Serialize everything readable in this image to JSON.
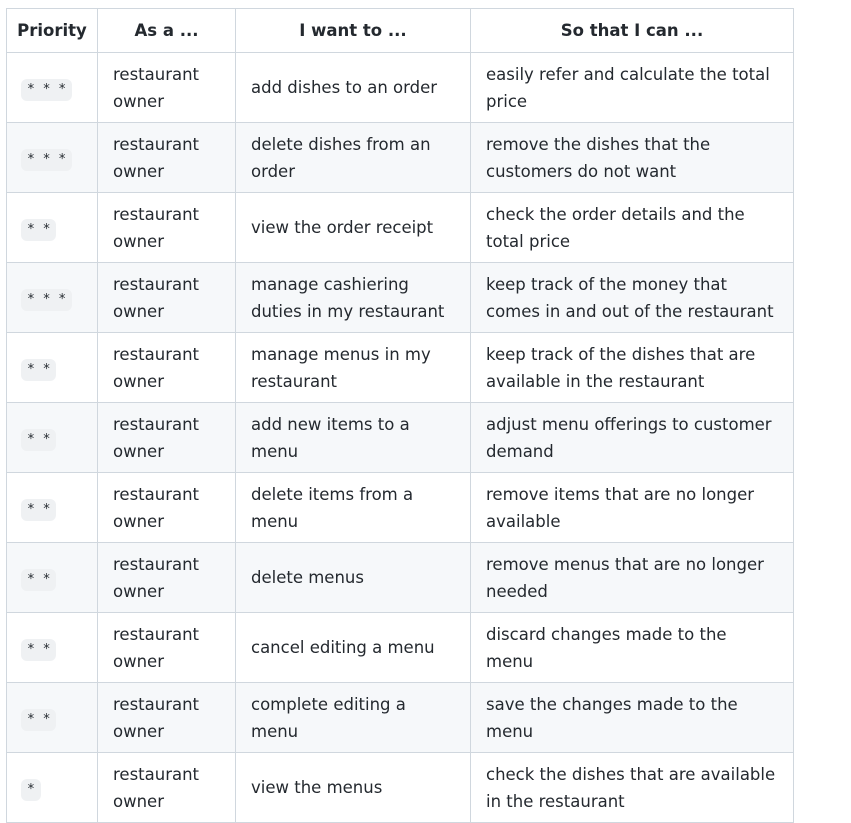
{
  "table": {
    "headers": [
      "Priority",
      "As a ...",
      "I want to ...",
      "So that I can ..."
    ],
    "rows": [
      {
        "priority": "* * *",
        "role": "restaurant owner",
        "want": "add dishes to an order",
        "so": "easily refer and calculate the total price"
      },
      {
        "priority": "* * *",
        "role": "restaurant owner",
        "want": "delete dishes from an order",
        "so": "remove the dishes that the customers do not want"
      },
      {
        "priority": "* *",
        "role": "restaurant owner",
        "want": "view the order receipt",
        "so": "check the order details and the total price"
      },
      {
        "priority": "* * *",
        "role": "restaurant owner",
        "want": "manage cashiering duties in my restaurant",
        "so": "keep track of the money that comes in and out of the restaurant"
      },
      {
        "priority": "* *",
        "role": "restaurant owner",
        "want": "manage menus in my restaurant",
        "so": "keep track of the dishes that are available in the restaurant"
      },
      {
        "priority": "* *",
        "role": "restaurant owner",
        "want": "add new items to a menu",
        "so": "adjust menu offerings to customer demand"
      },
      {
        "priority": "* *",
        "role": "restaurant owner",
        "want": "delete items from a menu",
        "so": "remove items that are no longer available"
      },
      {
        "priority": "* *",
        "role": "restaurant owner",
        "want": "delete menus",
        "so": "remove menus that are no longer needed"
      },
      {
        "priority": "* *",
        "role": "restaurant owner",
        "want": "cancel editing a menu",
        "so": "discard changes made to the menu"
      },
      {
        "priority": "* *",
        "role": "restaurant owner",
        "want": "complete editing a menu",
        "so": "save the changes made to the menu"
      },
      {
        "priority": "*",
        "role": "restaurant owner",
        "want": "view the menus",
        "so": "check the dishes that are available in the restaurant"
      }
    ]
  }
}
